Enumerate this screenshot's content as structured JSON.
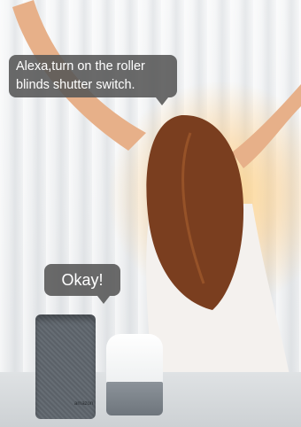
{
  "scene": {
    "speech_bubbles": [
      {
        "text_line1": "Alexa,turn on the roller",
        "text_line2": "blinds shutter switch."
      },
      {
        "text": "Okay!"
      }
    ],
    "speakers": {
      "echo_brand": "amazon"
    },
    "colors": {
      "bubble": "#555555",
      "glow": "#ffd68c",
      "hair": "#7a3e1f",
      "skin": "#e7b089"
    }
  }
}
